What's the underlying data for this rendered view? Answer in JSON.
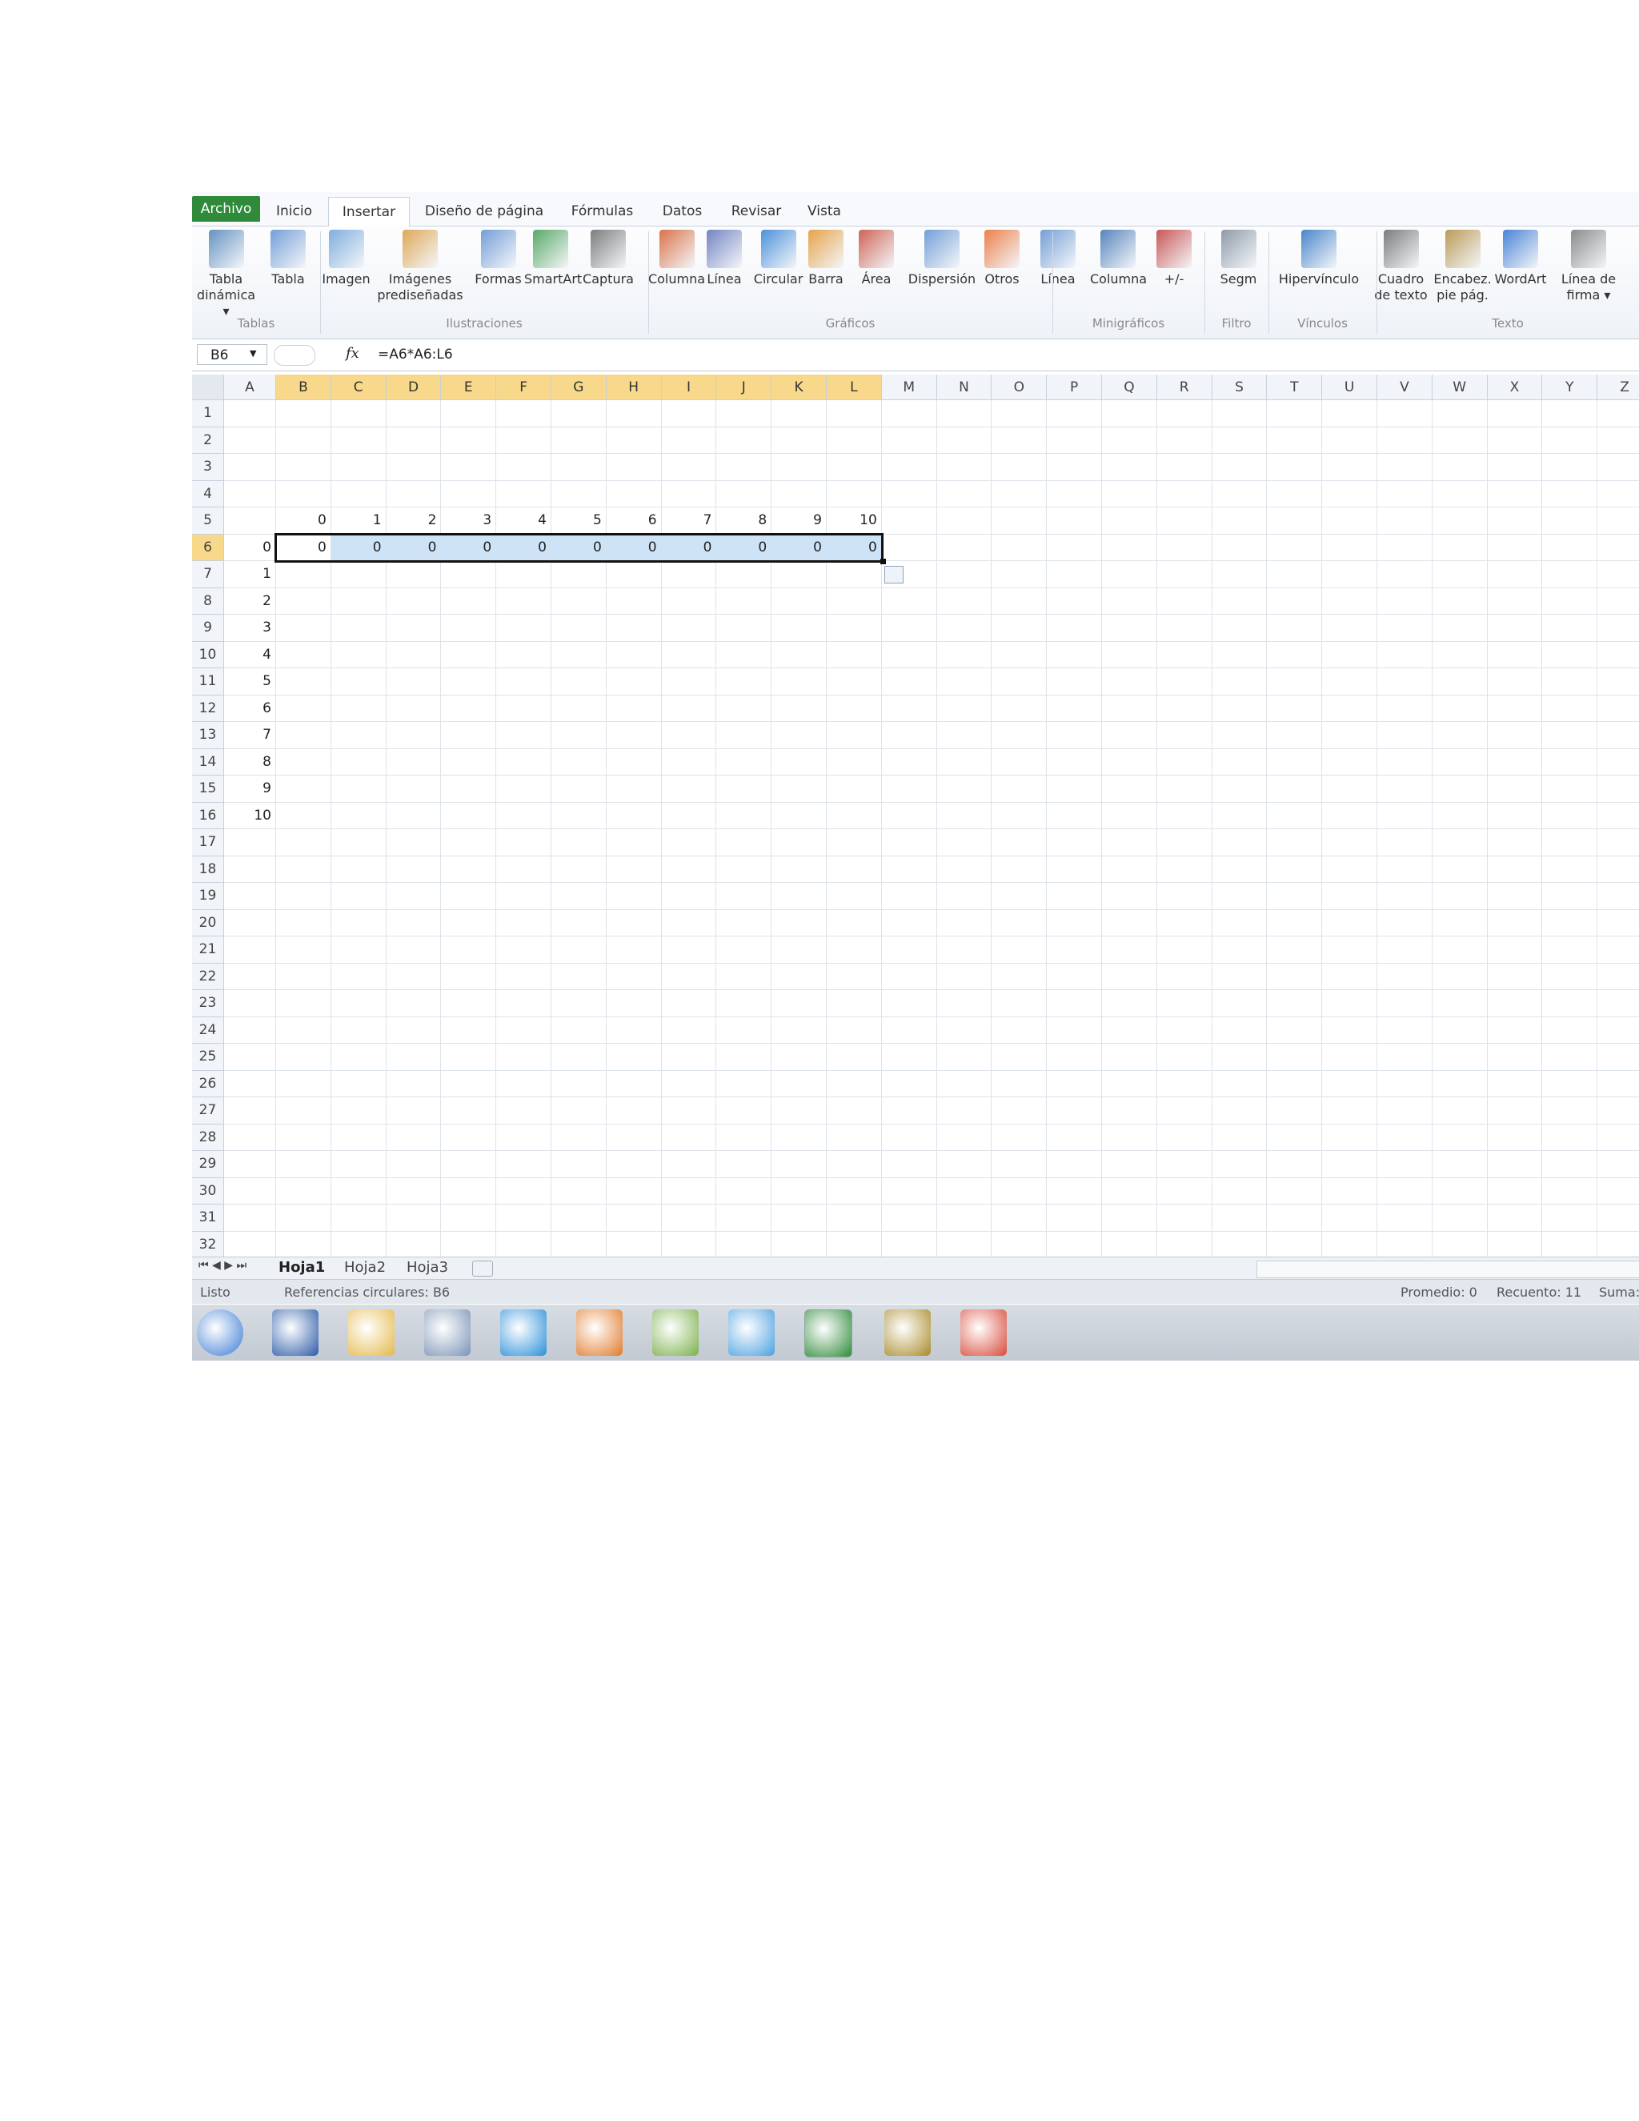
{
  "tabs": [
    "Archivo",
    "Inicio",
    "Insertar",
    "Diseño de página",
    "Fórmulas",
    "Datos",
    "Revisar",
    "Vista"
  ],
  "ribbon": {
    "groups": [
      "Tablas",
      "Ilustraciones",
      "Gráficos",
      "Minigráficos",
      "Filtro",
      "Vínculos",
      "Texto"
    ],
    "buttons": [
      {
        "label": "Tabla\ndinámica ▾",
        "icon": "pivot-table-icon"
      },
      {
        "label": "Tabla",
        "icon": "table-icon"
      },
      {
        "label": "Imagen",
        "icon": "picture-icon"
      },
      {
        "label": "Imágenes\nprediseñadas",
        "icon": "clip-art-icon"
      },
      {
        "label": "Formas",
        "icon": "shapes-icon"
      },
      {
        "label": "SmartArt",
        "icon": "smartart-icon"
      },
      {
        "label": "Captura",
        "icon": "screenshot-icon"
      },
      {
        "label": "Columna",
        "icon": "column-chart-icon"
      },
      {
        "label": "Línea",
        "icon": "line-chart-icon"
      },
      {
        "label": "Circular",
        "icon": "pie-chart-icon"
      },
      {
        "label": "Barra",
        "icon": "bar-chart-icon"
      },
      {
        "label": "Área",
        "icon": "area-chart-icon"
      },
      {
        "label": "Dispersión",
        "icon": "scatter-chart-icon"
      },
      {
        "label": "Otros",
        "icon": "other-charts-icon"
      },
      {
        "label": "Línea",
        "icon": "sparkline-line-icon"
      },
      {
        "label": "Columna",
        "icon": "sparkline-column-icon"
      },
      {
        "label": "+/-",
        "icon": "sparkline-winloss-icon"
      },
      {
        "label": "Segm",
        "icon": "slicer-icon"
      },
      {
        "label": "Hipervínculo",
        "icon": "hyperlink-icon"
      },
      {
        "label": "Cuadro\nde texto",
        "icon": "textbox-icon"
      },
      {
        "label": "Encabez.\npie pág.",
        "icon": "header-footer-icon"
      },
      {
        "label": "WordArt",
        "icon": "wordart-icon"
      },
      {
        "label": "Línea de\nfirma ▾",
        "icon": "signature-line-icon"
      }
    ]
  },
  "formula_bar": {
    "name_box": "B6",
    "fx": "fx",
    "formula": "=A6*A6:L6"
  },
  "columns": [
    "A",
    "B",
    "C",
    "D",
    "E",
    "F",
    "G",
    "H",
    "I",
    "J",
    "K",
    "L",
    "M",
    "N",
    "O",
    "P",
    "Q",
    "R",
    "S",
    "T",
    "U",
    "V",
    "W",
    "X",
    "Y",
    "Z"
  ],
  "rows": [
    "1",
    "2",
    "3",
    "4",
    "5",
    "6",
    "7",
    "8",
    "9",
    "10",
    "11",
    "12",
    "13",
    "14",
    "15",
    "16",
    "17",
    "18",
    "19",
    "20",
    "21",
    "22",
    "23",
    "24",
    "25",
    "26",
    "27",
    "28",
    "29",
    "30",
    "31",
    "32"
  ],
  "cells": {
    "row5": [
      "0",
      "1",
      "2",
      "3",
      "4",
      "5",
      "6",
      "7",
      "8",
      "9",
      "10"
    ],
    "row6": [
      "0",
      "0",
      "0",
      "0",
      "0",
      "0",
      "0",
      "0",
      "0",
      "0",
      "0",
      "0"
    ],
    "colA": [
      "1",
      "2",
      "3",
      "4",
      "5",
      "6",
      "7",
      "8",
      "9",
      "10"
    ]
  },
  "sheets": [
    "Hoja1",
    "Hoja2",
    "Hoja3"
  ],
  "status": {
    "mode": "Listo",
    "circular": "Referencias circulares: B6",
    "average": "Promedio: 0",
    "count": "Recuento: 11",
    "sum": "Suma:"
  },
  "taskbar": [
    "windows-start-icon",
    "word-icon",
    "file-explorer-icon",
    "calculator-icon",
    "internet-explorer-icon",
    "media-player-icon",
    "app-icon",
    "dropbox-icon",
    "excel-icon",
    "app-icon-2",
    "chrome-icon"
  ],
  "colors": {
    "file_tab": "#2f8a3a",
    "selection": "#cfe3f7",
    "header_selected": "#f8d88a"
  }
}
